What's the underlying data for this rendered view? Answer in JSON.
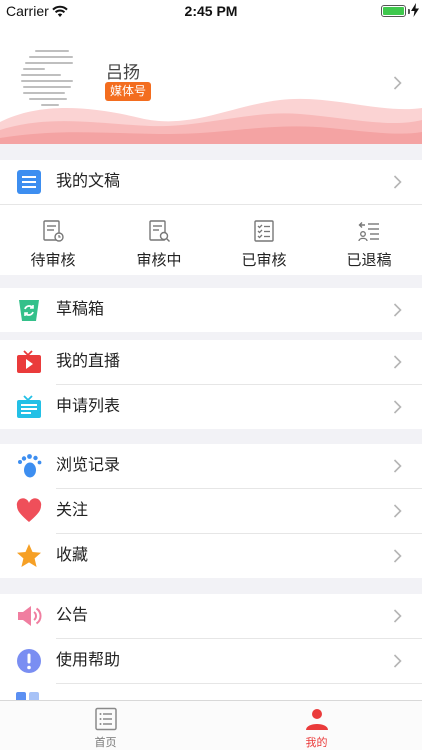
{
  "status_bar": {
    "carrier": "Carrier",
    "time": "2:45 PM"
  },
  "profile": {
    "name": "吕扬",
    "badge": "媒体号"
  },
  "menu": {
    "manuscripts": "我的文稿",
    "drafts": "草稿箱",
    "live": "我的直播",
    "applications": "申请列表",
    "history": "浏览记录",
    "follow": "关注",
    "favorites": "收藏",
    "notice": "公告",
    "help": "使用帮助"
  },
  "manuscript_status": [
    {
      "label": "待审核",
      "icon": "pending-doc-icon"
    },
    {
      "label": "审核中",
      "icon": "reviewing-doc-icon"
    },
    {
      "label": "已审核",
      "icon": "approved-doc-icon"
    },
    {
      "label": "已退稿",
      "icon": "returned-doc-icon"
    }
  ],
  "tabbar": [
    {
      "label": "首页",
      "icon": "list-doc-icon",
      "active": false
    },
    {
      "label": "我的",
      "icon": "person-icon",
      "active": true
    }
  ],
  "colors": {
    "accent": "#ea3b3b",
    "badge": "#f36d1f",
    "wave": "#f8b9b9"
  }
}
